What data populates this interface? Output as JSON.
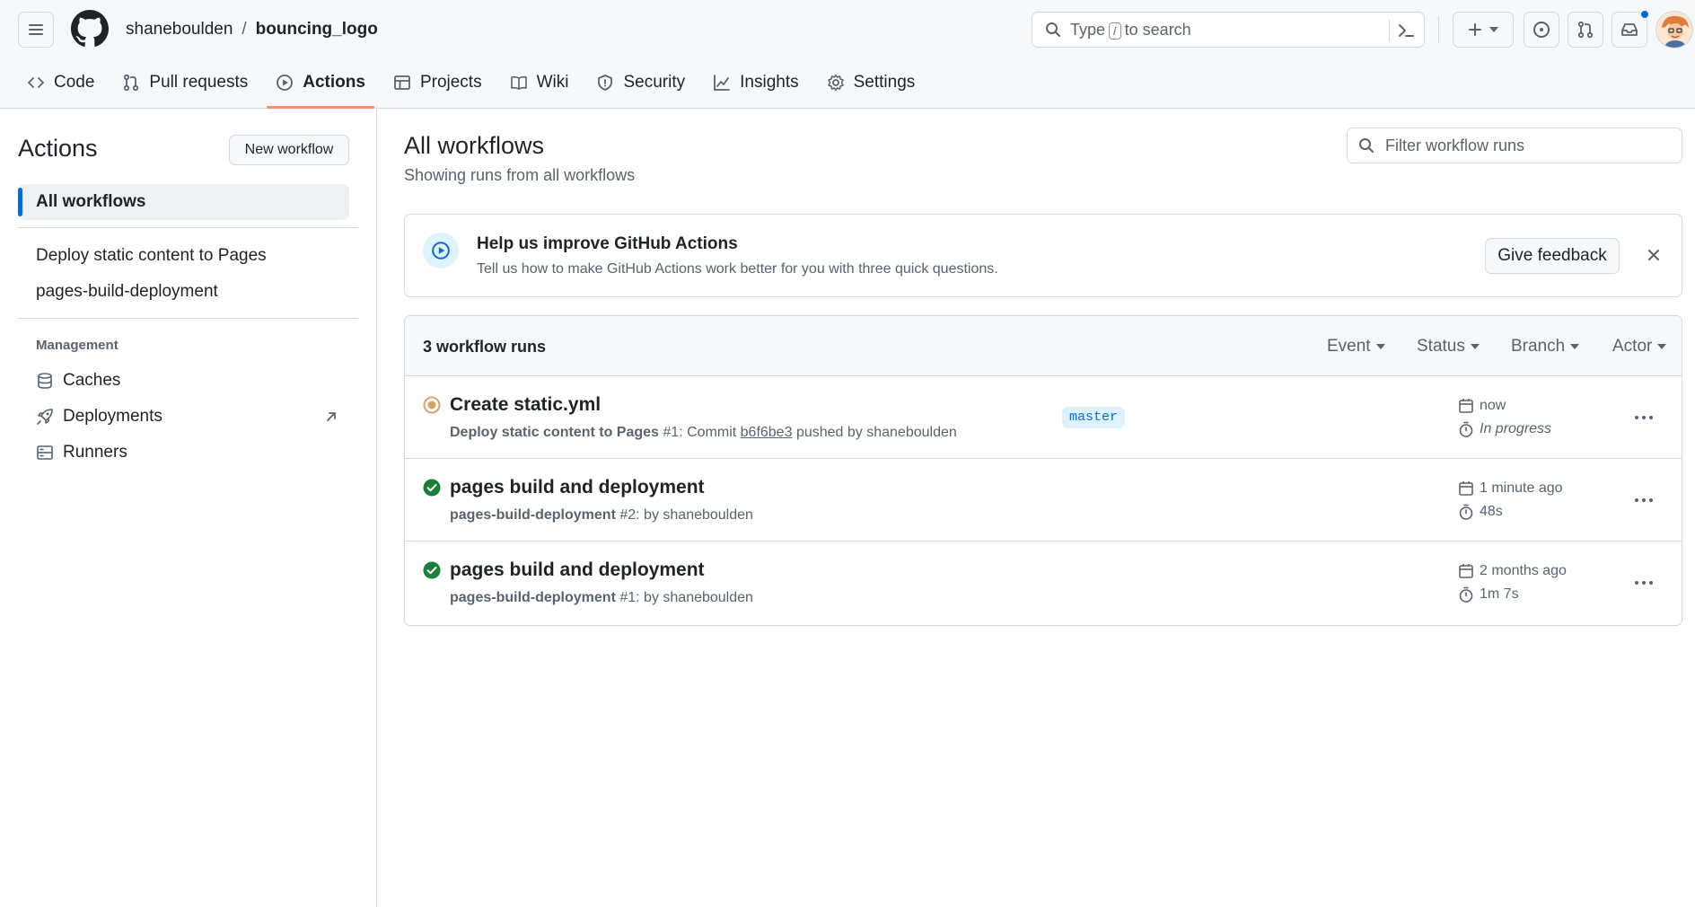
{
  "header": {
    "owner": "shaneboulden",
    "separator": "/",
    "repo": "bouncing_logo",
    "search": {
      "prefix": "Type",
      "key": "/",
      "suffix": "to search"
    }
  },
  "nav": [
    {
      "label": "Code",
      "icon": "code-icon"
    },
    {
      "label": "Pull requests",
      "icon": "git-pull-request-icon"
    },
    {
      "label": "Actions",
      "icon": "play-icon",
      "active": true
    },
    {
      "label": "Projects",
      "icon": "table-icon"
    },
    {
      "label": "Wiki",
      "icon": "book-icon"
    },
    {
      "label": "Security",
      "icon": "shield-icon"
    },
    {
      "label": "Insights",
      "icon": "graph-icon"
    },
    {
      "label": "Settings",
      "icon": "gear-icon"
    }
  ],
  "sidebar": {
    "title": "Actions",
    "new_workflow": "New workflow",
    "all_workflows": "All workflows",
    "workflows": [
      "Deploy static content to Pages",
      "pages-build-deployment"
    ],
    "management_heading": "Management",
    "management": [
      "Caches",
      "Deployments",
      "Runners"
    ]
  },
  "main": {
    "title": "All workflows",
    "subtitle": "Showing runs from all workflows",
    "filter_placeholder": "Filter workflow runs"
  },
  "feedback": {
    "title": "Help us improve GitHub Actions",
    "text": "Tell us how to make GitHub Actions work better for you with three quick questions.",
    "button": "Give feedback"
  },
  "runs": {
    "count": "3 workflow runs",
    "filters": [
      "Event",
      "Status",
      "Branch",
      "Actor"
    ],
    "items": [
      {
        "status": "in-progress",
        "title": "Create static.yml",
        "workflow": "Deploy static content to Pages",
        "number": "#1",
        "meta_mid": ": Commit",
        "sha": "b6f6be3",
        "meta_end": "pushed by shaneboulden",
        "branch": "master",
        "time": "now",
        "duration": "In progress"
      },
      {
        "status": "success",
        "title": "pages build and deployment",
        "workflow": "pages-build-deployment",
        "number": "#2",
        "meta_end": ": by shaneboulden",
        "time": "1 minute ago",
        "duration": "48s"
      },
      {
        "status": "success",
        "title": "pages build and deployment",
        "workflow": "pages-build-deployment",
        "number": "#1",
        "meta_end": ": by shaneboulden",
        "time": "2 months ago",
        "duration": "1m 7s"
      }
    ]
  },
  "colors": {
    "accent": "#0969da",
    "nav_underline": "#fd8c73",
    "success": "#1a7f37",
    "in_progress": "#d4a56a"
  }
}
